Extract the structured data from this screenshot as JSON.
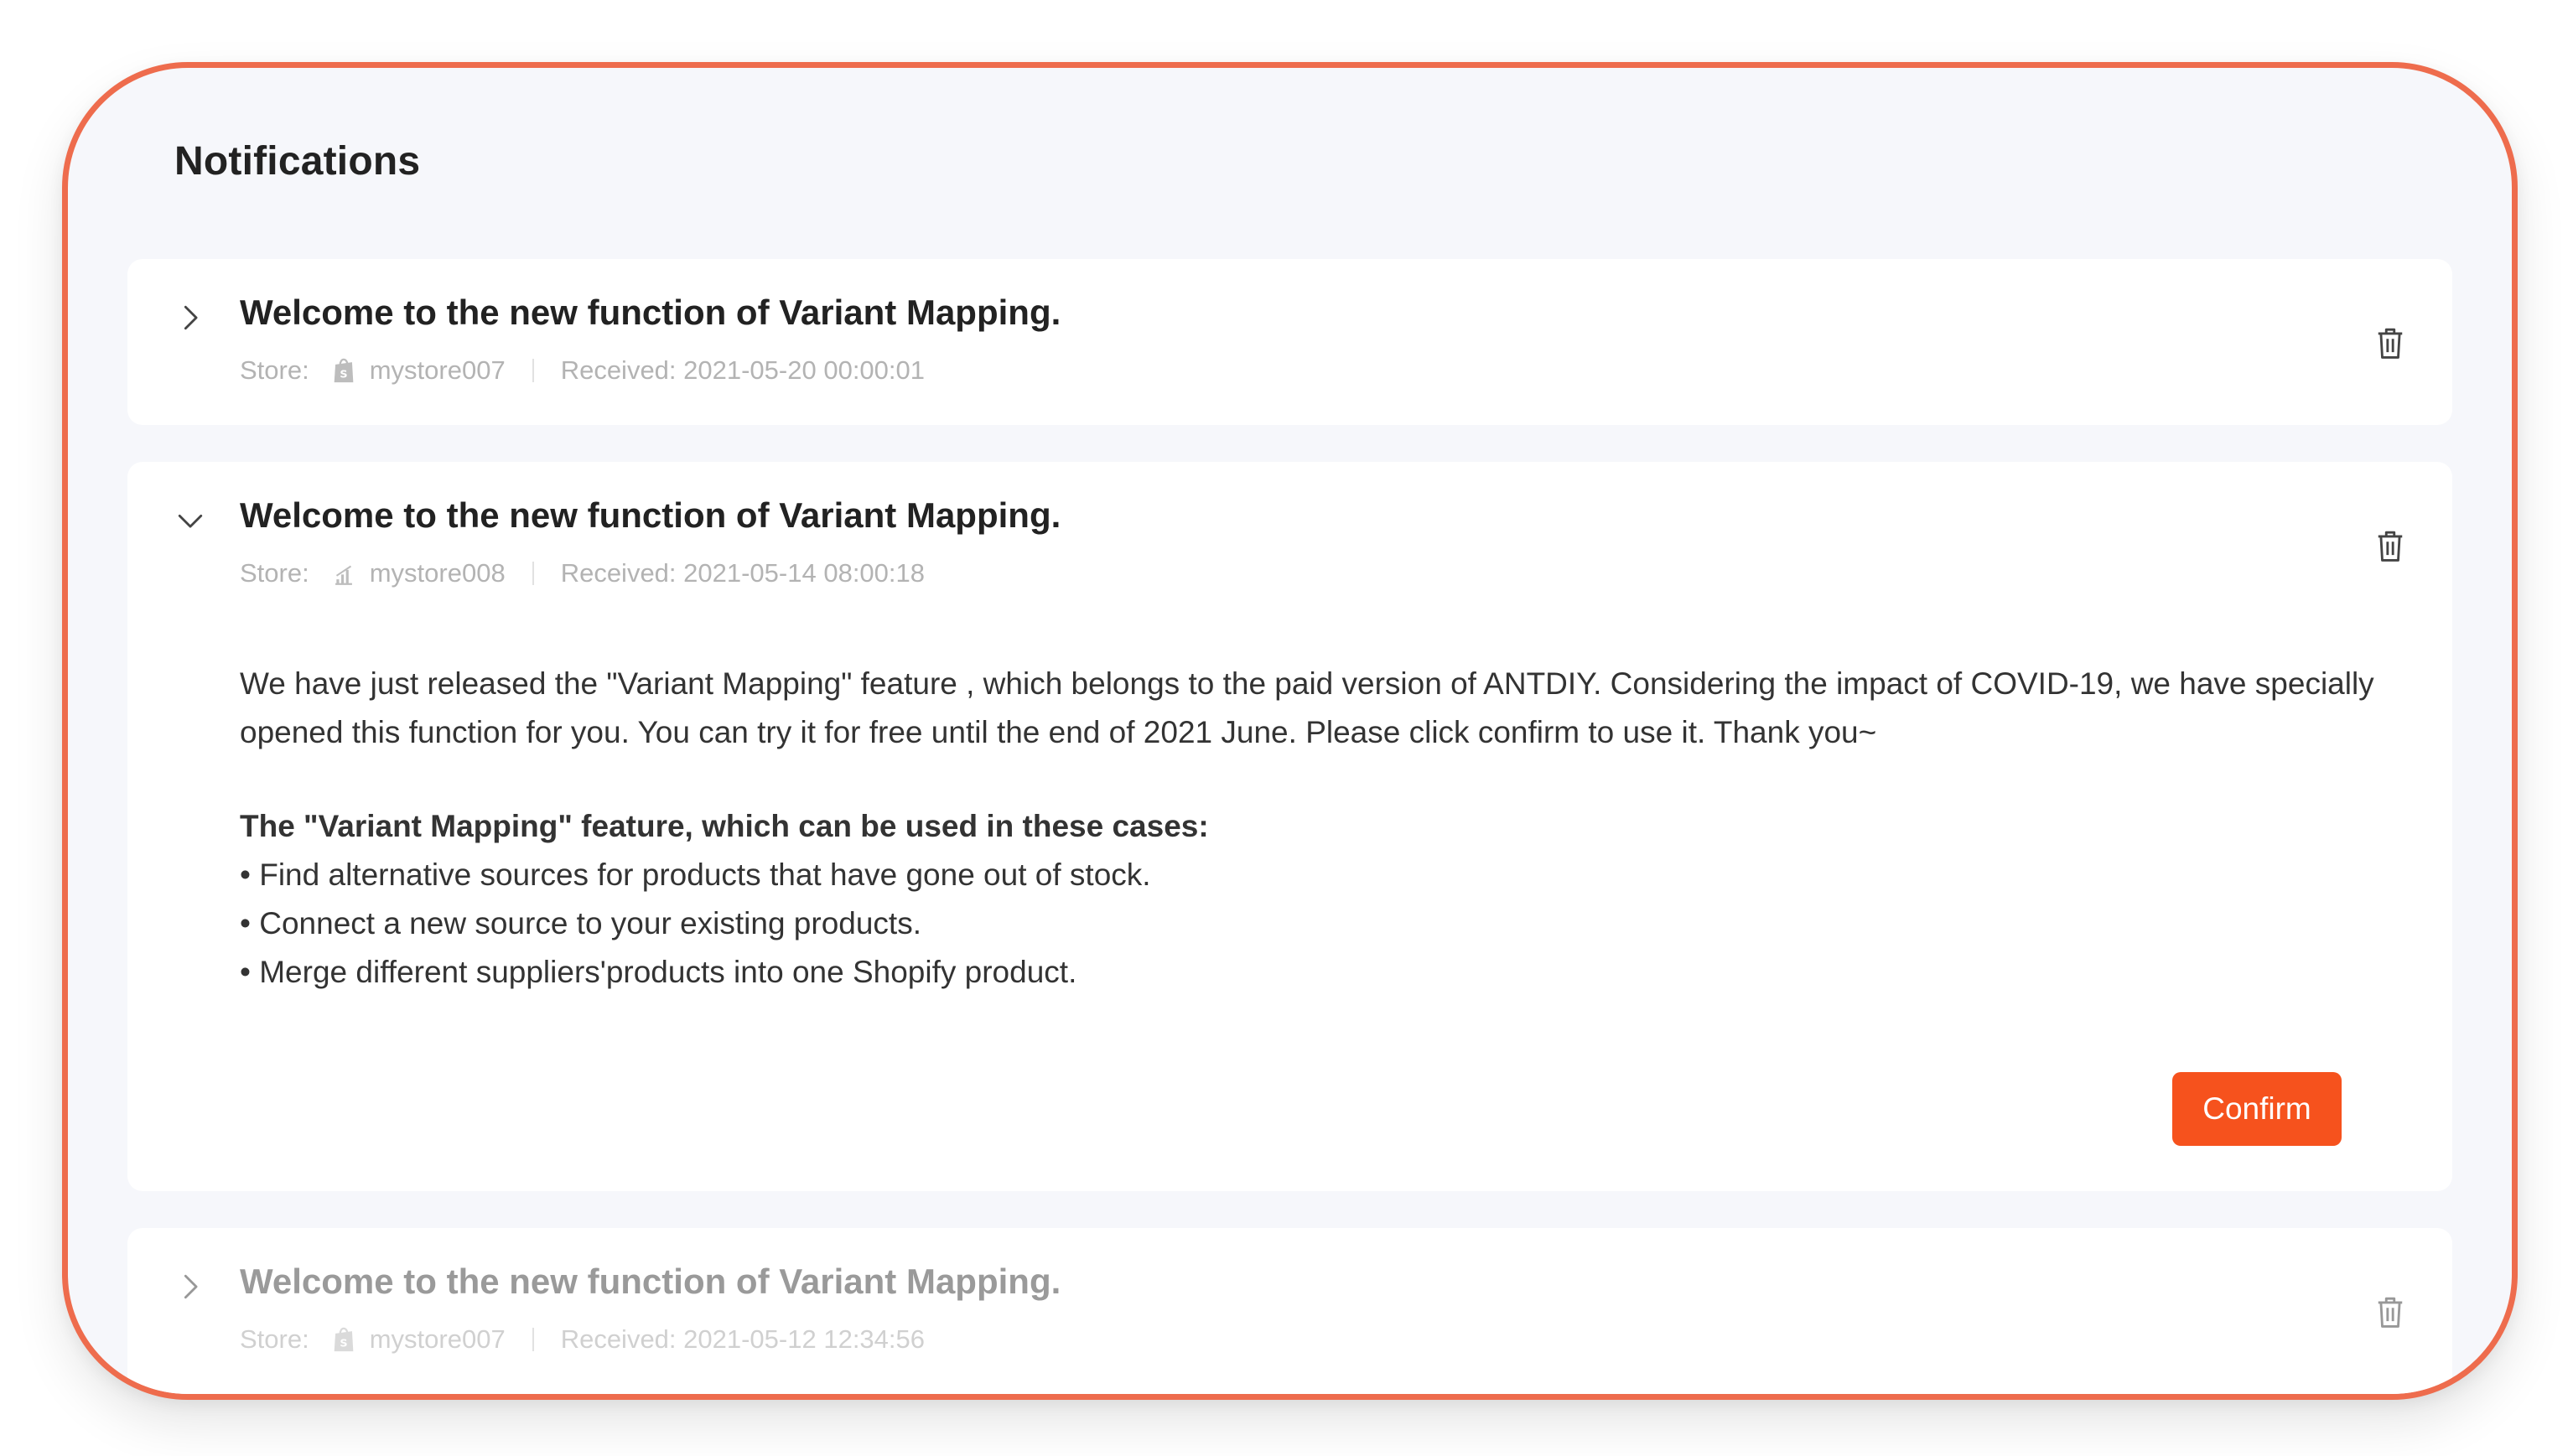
{
  "page": {
    "title": "Notifications"
  },
  "notifications": [
    {
      "title": "Welcome to the new function of Variant Mapping.",
      "store_label": "Store:",
      "store_name": "mystore007",
      "received": "Received: 2021-05-20 00:00:01",
      "expanded": false,
      "store_icon": "shopify-bag-icon"
    },
    {
      "title": "Welcome to the new function of Variant Mapping.",
      "store_label": "Store:",
      "store_name": "mystore008",
      "received": "Received: 2021-05-14 08:00:18",
      "expanded": true,
      "store_icon": "store-chart-icon",
      "body": "We have just released the \"Variant Mapping\" feature , which belongs to the paid version of ANTDIY. Considering the impact of COVID-19, we have specially opened this function for you. You can try it for free until the end of 2021 June. Please click confirm to use it. Thank you~",
      "cases_title": "The \"Variant Mapping\" feature, which can be used in these cases:",
      "cases": [
        "Find alternative sources for products that have gone out of stock.",
        "Connect a new source to your existing products.",
        "Merge different suppliers'products into one Shopify product."
      ],
      "confirm_label": "Confirm"
    },
    {
      "title": "Welcome to the new function of Variant Mapping.",
      "store_label": "Store:",
      "store_name": "mystore007",
      "received": "Received: 2021-05-12 12:34:56",
      "expanded": false,
      "store_icon": "shopify-bag-icon"
    }
  ],
  "colors": {
    "frame_border": "#ee6c4d",
    "accent": "#f6521d",
    "background": "#f6f7fb"
  }
}
